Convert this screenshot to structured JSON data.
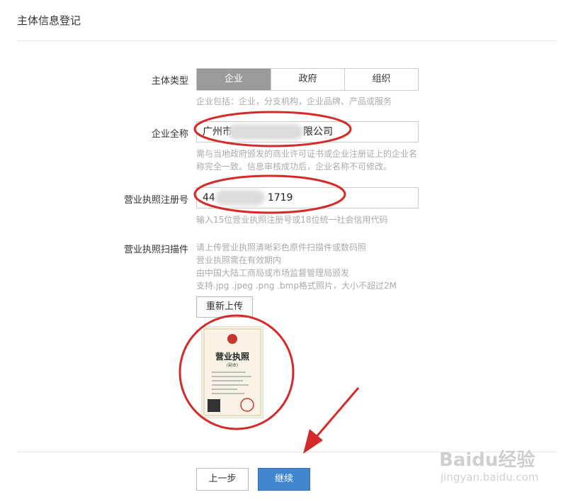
{
  "page": {
    "title": "主体信息登记"
  },
  "entity_type": {
    "label": "主体类型",
    "options": [
      "企业",
      "政府",
      "组织"
    ],
    "selected": "企业",
    "hint": "企业包括：企业，分支机构，企业品牌、产品或服务"
  },
  "company_name": {
    "label": "企业全称",
    "value_prefix": "广州市",
    "value_suffix": "限公司",
    "hint_line1": "需与当地政府颁发的商业许可证书或企业注册证上的企业名",
    "hint_line2": "称完全一致。信息审核成功后，企业名称不可修改。"
  },
  "license_number": {
    "label": "营业执照注册号",
    "value_prefix": "44",
    "value_suffix": "1719",
    "hint": "输入15位营业执照注册号或18位统一社会信用代码"
  },
  "license_scan": {
    "label": "营业执照扫描件",
    "hints": [
      "请上传营业执照清晰彩色原件扫描件或数码照",
      "营业执照需在有效期内",
      "由中国大陆工商局或市场监督管理局颁发",
      "支持.jpg .jpeg .png .bmp格式照片，大小不超过2M"
    ],
    "reupload_label": "重新上传",
    "thumb_title": "营业执照",
    "thumb_subtitle": "(副本)"
  },
  "actions": {
    "prev_label": "上一步",
    "next_label": "继续"
  },
  "watermark": {
    "brand": "Baidu经验",
    "url": "jingyan.baidu.com"
  },
  "colors": {
    "accent": "#3f86cf",
    "annotation": "#d42a2a",
    "selected_seg": "#9a9a9a"
  }
}
